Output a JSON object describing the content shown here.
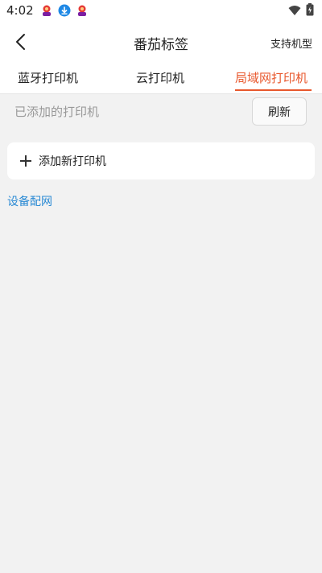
{
  "status_bar": {
    "time": "4:02",
    "notification_icons": [
      "avatar-notification-icon",
      "download-icon",
      "avatar-notification-icon"
    ],
    "system_icons": [
      "wifi-icon",
      "battery-icon"
    ]
  },
  "header": {
    "title": "番茄标签",
    "back_icon": "back-arrow-icon",
    "support_link": "支持机型"
  },
  "tabs": [
    {
      "label": "蓝牙打印机",
      "active": false
    },
    {
      "label": "云打印机",
      "active": false
    },
    {
      "label": "局域网打印机",
      "active": true
    }
  ],
  "main": {
    "added_printers_label": "已添加的打印机",
    "refresh_button": "刷新",
    "add_printer_label": "添加新打印机",
    "device_network_link": "设备配网"
  },
  "colors": {
    "accent": "#e8582d",
    "link": "#2a8ad4",
    "background": "#f2f2f2"
  }
}
